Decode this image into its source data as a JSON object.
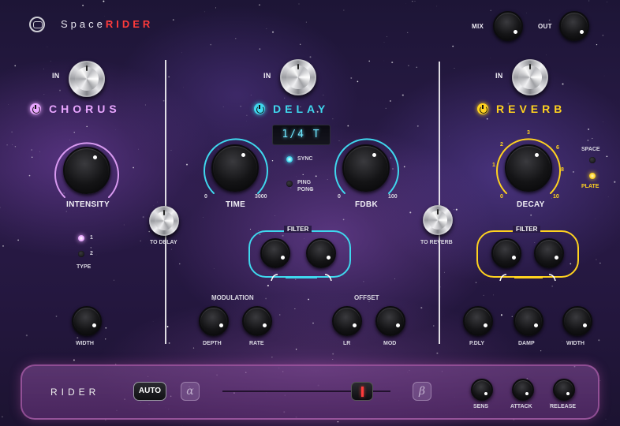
{
  "brand": {
    "name_a": "Space",
    "name_b": "RIDER",
    "accent": "#ff3b3b"
  },
  "header": {
    "mix_label": "MIX",
    "out_label": "OUT"
  },
  "chorus": {
    "title": "CHORUS",
    "color": "#e9a6ff",
    "in_label": "IN",
    "intensity_label": "INTENSITY",
    "type_label": "TYPE",
    "type_options": [
      "1",
      "2"
    ],
    "to_delay_label": "TO DELAY",
    "width_label": "WIDTH"
  },
  "delay": {
    "title": "DELAY",
    "color": "#3fd8ee",
    "in_label": "IN",
    "display_value": "1/4 T",
    "time_label": "TIME",
    "time_min": "0",
    "time_max": "3000",
    "fdbk_label": "FDBK",
    "fdbk_min": "0",
    "fdbk_max": "100",
    "sync_label": "SYNC",
    "pingpong_label_1": "PING",
    "pingpong_label_2": "PONG",
    "filter_label": "FILTER",
    "modulation_label": "MODULATION",
    "depth_label": "DEPTH",
    "rate_label": "RATE",
    "offset_label": "OFFSET",
    "lr_label": "LR",
    "mod_label": "MOD",
    "to_reverb_label": "TO REVERB"
  },
  "reverb": {
    "title": "REVERB",
    "color": "#ffd21f",
    "in_label": "IN",
    "decay_label": "DECAY",
    "decay_scale": [
      "0",
      "1",
      "2",
      "3",
      "6",
      "8",
      "10"
    ],
    "space_label": "SPACE",
    "plate_label": "PLATE",
    "filter_label": "FILTER",
    "pdly_label": "P.DLY",
    "damp_label": "DAMP",
    "width_label": "WIDTH"
  },
  "rider": {
    "title": "RIDER",
    "auto_label": "AUTO",
    "alpha_label": "α",
    "beta_label": "β",
    "sens_label": "SENS",
    "attack_label": "ATTACK",
    "release_label": "RELEASE"
  }
}
